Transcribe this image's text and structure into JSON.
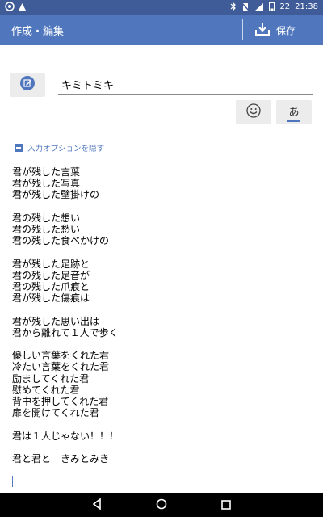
{
  "status_bar": {
    "time": "21:38",
    "battery": "22"
  },
  "app_bar": {
    "title": "作成・編集",
    "save_label": "保存"
  },
  "editor": {
    "title_value": "キミトミキ",
    "toggle_options_label": "入力オプションを隠す",
    "kana_label": "あ",
    "body": "君が残した言葉\n君が残した写真\n君が残した壁掛けの\n\n君の残した想い\n君の残した愁い\n君の残した食べかけの\n\n君が残した足跡と\n君の残した足音が\n君の残した爪痕と\n君が残した傷痕は\n\n君が残した思い出は\n君から離れて１人で歩く\n\n優しい言葉をくれた君\n冷たい言葉をくれた君\n励ましてくれた君\n慰めてくれた君\n背中を押してくれた君\n扉を開けてくれた君\n\n君は１人じゃない！！！\n\n君と君と　きみとみき"
  },
  "colors": {
    "app_bar": "#5077be",
    "status_bar": "#3f5c99",
    "accent": "#5077be"
  },
  "icons": [
    "edit-icon",
    "download-icon",
    "smiley-icon",
    "back-icon",
    "home-icon",
    "recents-icon"
  ]
}
